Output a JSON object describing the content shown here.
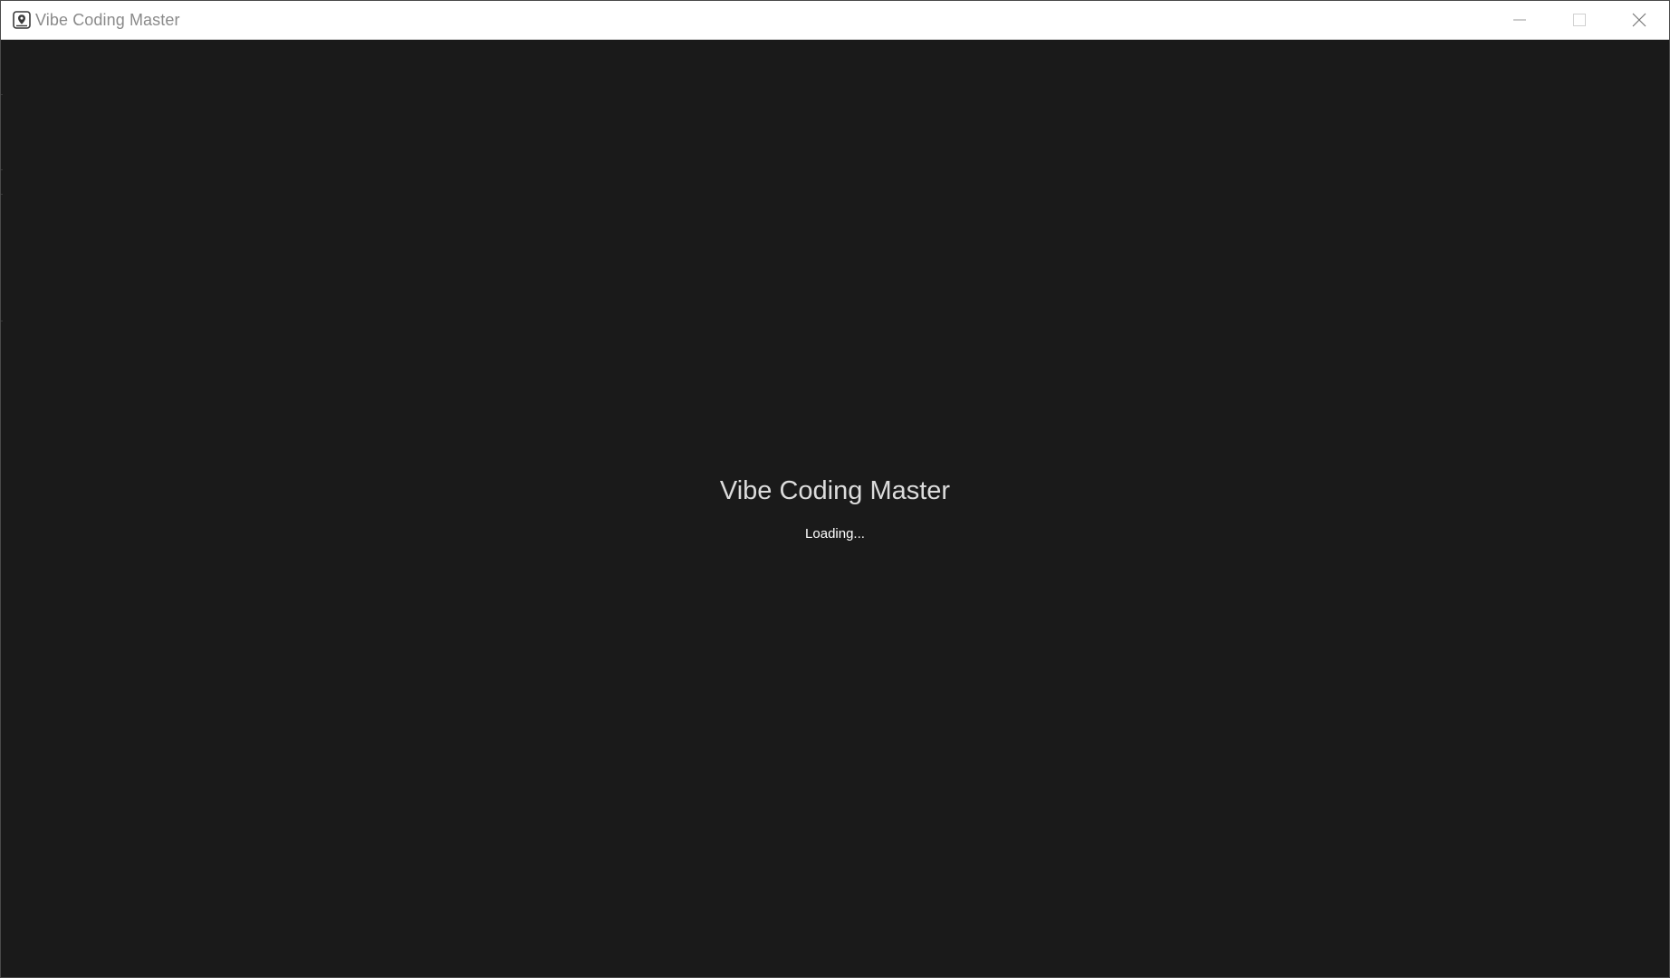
{
  "window": {
    "title": "Vibe Coding Master",
    "app_icon": "location-pin-app-icon",
    "controls": {
      "minimize_icon": "minimize-icon",
      "maximize_icon": "maximize-icon",
      "close_icon": "close-icon"
    }
  },
  "splash": {
    "title": "Vibe Coding Master",
    "status": "Loading..."
  },
  "colors": {
    "background": "#1a1a1a",
    "titlebar": "#ffffff",
    "title_text": "#8a8a8a",
    "splash_title": "#dcdcdc",
    "splash_status": "#ffffff"
  }
}
